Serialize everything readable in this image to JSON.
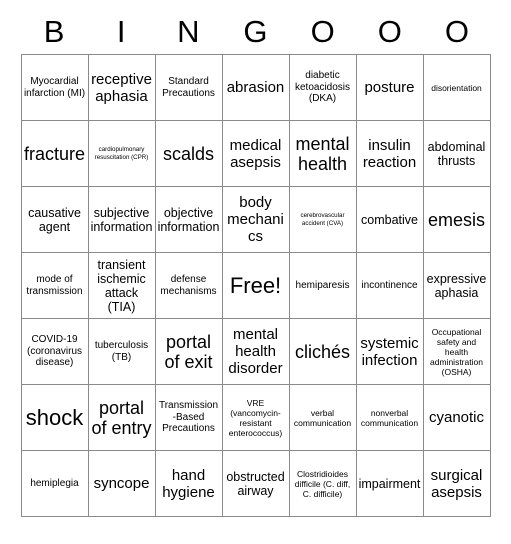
{
  "card": {
    "title": "BINGO card",
    "header_letters": [
      "B",
      "I",
      "N",
      "G",
      "O",
      "O",
      "O"
    ],
    "free_space": "Free!",
    "grid_color": "#8a8a8a",
    "background_color": "#ffffff",
    "text_color": "#000000",
    "columns": 7,
    "rows": 7,
    "cells": [
      [
        {
          "text": "Myocardial infarction (MI)",
          "size": "s"
        },
        {
          "text": "receptive aphasia",
          "size": "l"
        },
        {
          "text": "Standard Precautions",
          "size": "s"
        },
        {
          "text": "abrasion",
          "size": "l"
        },
        {
          "text": "diabetic ketoacidosis (DKA)",
          "size": "s"
        },
        {
          "text": "posture",
          "size": "l"
        },
        {
          "text": "disorientation",
          "size": "xs"
        }
      ],
      [
        {
          "text": "fracture",
          "size": "xl"
        },
        {
          "text": "cardiopulmonary resuscitation (CPR)",
          "size": "xxs"
        },
        {
          "text": "scalds",
          "size": "xl"
        },
        {
          "text": "medical asepsis",
          "size": "l"
        },
        {
          "text": "mental health",
          "size": "xl"
        },
        {
          "text": "insulin reaction",
          "size": "l"
        },
        {
          "text": "abdominal thrusts",
          "size": "m"
        }
      ],
      [
        {
          "text": "causative agent",
          "size": "m"
        },
        {
          "text": "subjective information",
          "size": "m"
        },
        {
          "text": "objective information",
          "size": "m"
        },
        {
          "text": "body mechanics",
          "size": "l"
        },
        {
          "text": "cerebrovascular accident (CVA)",
          "size": "xxs"
        },
        {
          "text": "combative",
          "size": "m"
        },
        {
          "text": "emesis",
          "size": "xl"
        }
      ],
      [
        {
          "text": "mode of transmission",
          "size": "s"
        },
        {
          "text": "transient ischemic attack (TIA)",
          "size": "m"
        },
        {
          "text": "defense mechanisms",
          "size": "s"
        },
        {
          "text": "Free!",
          "size": "xxl"
        },
        {
          "text": "hemiparesis",
          "size": "s"
        },
        {
          "text": "incontinence",
          "size": "s"
        },
        {
          "text": "expressive aphasia",
          "size": "m"
        }
      ],
      [
        {
          "text": "COVID-19 (coronavirus disease)",
          "size": "s"
        },
        {
          "text": "tuberculosis (TB)",
          "size": "s"
        },
        {
          "text": "portal of exit",
          "size": "xl"
        },
        {
          "text": "mental health disorder",
          "size": "l"
        },
        {
          "text": "clichés",
          "size": "xl"
        },
        {
          "text": "systemic infection",
          "size": "l"
        },
        {
          "text": "Occupational safety and health administration (OSHA)",
          "size": "xs"
        }
      ],
      [
        {
          "text": "shock",
          "size": "xxl"
        },
        {
          "text": "portal of entry",
          "size": "xl"
        },
        {
          "text": "Transmission-Based Precautions",
          "size": "s"
        },
        {
          "text": "VRE (vancomycin-resistant enterococcus)",
          "size": "xs"
        },
        {
          "text": "verbal communication",
          "size": "xs"
        },
        {
          "text": "nonverbal communication",
          "size": "xs"
        },
        {
          "text": "cyanotic",
          "size": "l"
        }
      ],
      [
        {
          "text": "hemiplegia",
          "size": "s"
        },
        {
          "text": "syncope",
          "size": "l"
        },
        {
          "text": "hand hygiene",
          "size": "l"
        },
        {
          "text": "obstructed airway",
          "size": "m"
        },
        {
          "text": "Clostridioides difficile (C. diff, C. difficile)",
          "size": "xs"
        },
        {
          "text": "impairment",
          "size": "m"
        },
        {
          "text": "surgical asepsis",
          "size": "l"
        }
      ]
    ]
  }
}
